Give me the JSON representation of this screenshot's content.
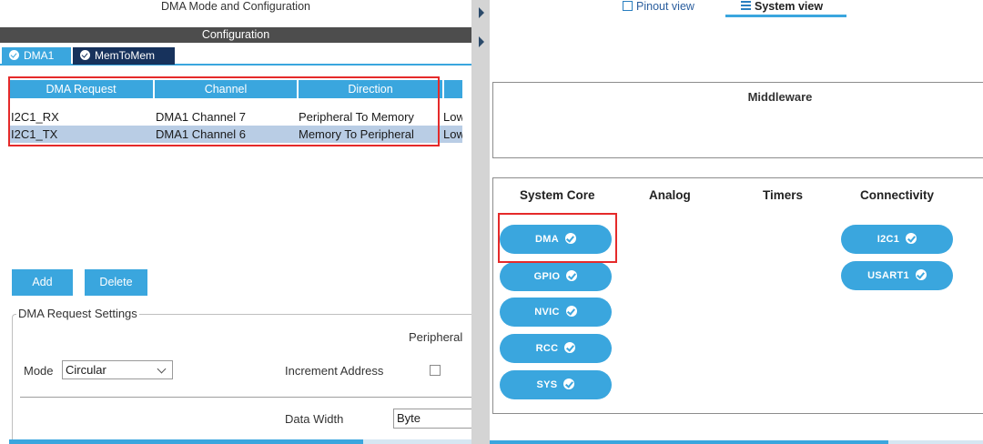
{
  "left_panel": {
    "title": "DMA Mode and Configuration",
    "config_bar": "Configuration",
    "tabs": [
      {
        "label": "DMA1",
        "icon": "check-circle-icon"
      },
      {
        "label": "MemToMem",
        "icon": "check-circle-icon"
      }
    ],
    "table": {
      "headers": [
        "DMA Request",
        "Channel",
        "Direction",
        ""
      ],
      "rows": [
        {
          "request": "I2C1_RX",
          "channel": "DMA1 Channel 7",
          "direction": "Peripheral To Memory",
          "priority": "Low"
        },
        {
          "request": "I2C1_TX",
          "channel": "DMA1 Channel 6",
          "direction": "Memory To Peripheral",
          "priority": "Low"
        }
      ]
    },
    "buttons": {
      "add": "Add",
      "delete": "Delete"
    },
    "settings": {
      "legend": "DMA Request Settings",
      "peripheral_label": "Peripheral",
      "mode_label": "Mode",
      "mode_value": "Circular",
      "increment_label": "Increment Address",
      "increment_checked": false,
      "data_width_label": "Data Width",
      "data_width_value": "Byte"
    }
  },
  "right_panel": {
    "view_tabs": [
      {
        "label": "Pinout view",
        "icon": "chip-icon"
      },
      {
        "label": "System view",
        "icon": "list-icon",
        "active": true
      }
    ],
    "middleware_title": "Middleware",
    "categories": [
      "System Core",
      "Analog",
      "Timers",
      "Connectivity"
    ],
    "system_core": [
      "DMA",
      "GPIO",
      "NVIC",
      "RCC",
      "SYS"
    ],
    "connectivity": [
      "I2C1",
      "USART1"
    ]
  },
  "colors": {
    "accent": "#3aa6de",
    "dark_tab": "#17325c",
    "selected_row": "#b9cde5",
    "highlight_box": "#e52a2a"
  }
}
